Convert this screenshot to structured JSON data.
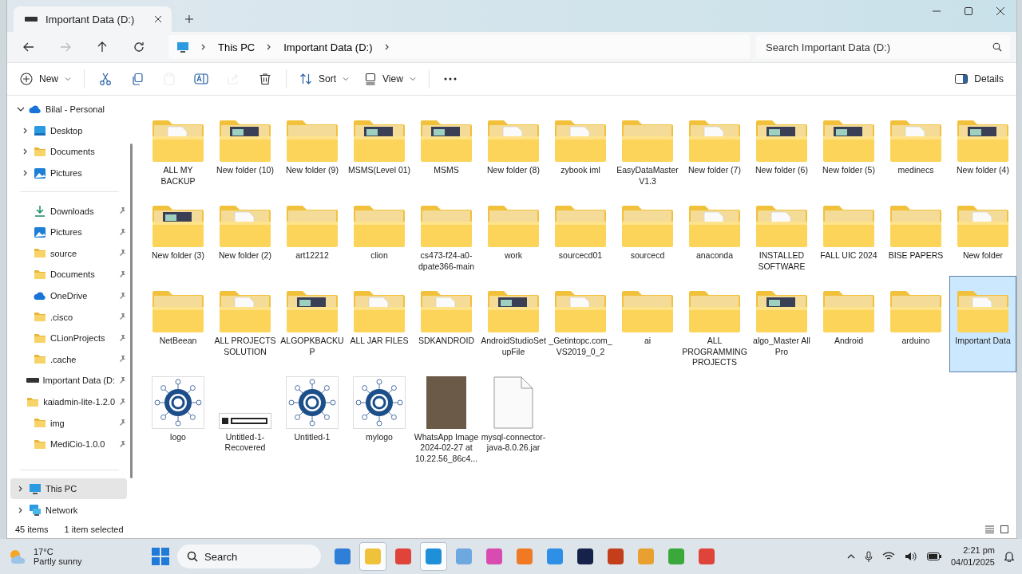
{
  "tab": {
    "title": "Important Data (D:)",
    "selected": true
  },
  "nav": [
    {
      "kind": "back",
      "disabled": false
    },
    {
      "kind": "forward",
      "disabled": true
    },
    {
      "kind": "up",
      "disabled": false
    },
    {
      "kind": "refresh",
      "disabled": false
    }
  ],
  "breadcrumb": [
    "This PC",
    "Important Data (D:)"
  ],
  "search": {
    "placeholder": "Search Important Data (D:)"
  },
  "toolbar": [
    {
      "kind": "new",
      "label": "New",
      "disabled": false
    },
    {
      "kind": "cut",
      "disabled": false
    },
    {
      "kind": "copy",
      "disabled": false
    },
    {
      "kind": "paste",
      "disabled": true
    },
    {
      "kind": "rename",
      "disabled": false
    },
    {
      "kind": "share",
      "disabled": true
    },
    {
      "kind": "delete",
      "disabled": false
    },
    {
      "kind": "sort",
      "label": "Sort",
      "disabled": false
    },
    {
      "kind": "view",
      "label": "View",
      "disabled": false
    },
    {
      "kind": "more",
      "disabled": false
    }
  ],
  "details_button": "Details",
  "sidebar": {
    "sections": [
      [
        {
          "label": "Bilal - Personal",
          "kind": "cloud",
          "expanded": true,
          "children": [
            {
              "label": "Desktop",
              "kind": "desktop",
              "expanded": false
            },
            {
              "label": "Documents",
              "kind": "folder",
              "expanded": false
            },
            {
              "label": "Pictures",
              "kind": "pictures",
              "expanded": false
            }
          ]
        }
      ],
      [
        {
          "label": "Downloads",
          "kind": "download",
          "pinned": true
        },
        {
          "label": "Pictures",
          "kind": "pictures",
          "pinned": true
        },
        {
          "label": "source",
          "kind": "folder",
          "pinned": true
        },
        {
          "label": "Documents",
          "kind": "folder",
          "pinned": true
        },
        {
          "label": "OneDrive",
          "kind": "cloud",
          "pinned": true
        },
        {
          "label": ".cisco",
          "kind": "folder",
          "pinned": true
        },
        {
          "label": "CLionProjects",
          "kind": "folder",
          "pinned": true
        },
        {
          "label": ".cache",
          "kind": "folder",
          "pinned": true
        },
        {
          "label": "Important Data (D:",
          "kind": "drive",
          "pinned": true
        },
        {
          "label": "kaiadmin-lite-1.2.0",
          "kind": "folder",
          "pinned": true
        },
        {
          "label": "img",
          "kind": "folder",
          "pinned": true
        },
        {
          "label": "MediCio-1.0.0",
          "kind": "folder",
          "pinned": true
        }
      ],
      [
        {
          "label": "This PC",
          "kind": "pc",
          "expanded": false,
          "selected": true
        },
        {
          "label": "Network",
          "kind": "network",
          "expanded": false,
          "selected": false
        }
      ]
    ]
  },
  "items": [
    {
      "name": "ALL MY BACKUP",
      "kind": "docfolder",
      "selected": false
    },
    {
      "name": "New folder (10)",
      "kind": "picfolder",
      "selected": false
    },
    {
      "name": "New folder (9)",
      "kind": "folder",
      "selected": false
    },
    {
      "name": "MSMS(Level 01)",
      "kind": "picfolder",
      "selected": false
    },
    {
      "name": "MSMS",
      "kind": "picfolder",
      "selected": false
    },
    {
      "name": "New folder (8)",
      "kind": "docfolder",
      "selected": false
    },
    {
      "name": "zybook iml",
      "kind": "docfolder",
      "selected": false
    },
    {
      "name": "EasyDataMaster V1.3",
      "kind": "folder",
      "selected": false
    },
    {
      "name": "New folder (7)",
      "kind": "docfolder",
      "selected": false
    },
    {
      "name": "New folder (6)",
      "kind": "picfolder",
      "selected": false
    },
    {
      "name": "New folder (5)",
      "kind": "picfolder",
      "selected": false
    },
    {
      "name": "medinecs",
      "kind": "docfolder",
      "selected": false
    },
    {
      "name": "New folder (4)",
      "kind": "picfolder",
      "selected": false
    },
    {
      "name": "New folder (3)",
      "kind": "picfolder",
      "selected": false
    },
    {
      "name": "New folder (2)",
      "kind": "docfolder",
      "selected": false
    },
    {
      "name": "art12212",
      "kind": "folder",
      "selected": false
    },
    {
      "name": "clion",
      "kind": "folder",
      "selected": false
    },
    {
      "name": "cs473-f24-a0-dpate366-main",
      "kind": "folder",
      "selected": false
    },
    {
      "name": "work",
      "kind": "folder",
      "selected": false
    },
    {
      "name": "sourcecd01",
      "kind": "folder",
      "selected": false
    },
    {
      "name": "sourcecd",
      "kind": "folder",
      "selected": false
    },
    {
      "name": "anaconda",
      "kind": "docfolder",
      "selected": false
    },
    {
      "name": "INSTALLED SOFTWARE",
      "kind": "docfolder",
      "selected": false
    },
    {
      "name": "FALL UIC 2024",
      "kind": "folder",
      "selected": false
    },
    {
      "name": "BISE PAPERS",
      "kind": "folder",
      "selected": false
    },
    {
      "name": "New folder",
      "kind": "docfolder",
      "selected": false
    },
    {
      "name": "NetBeean",
      "kind": "folder",
      "selected": false
    },
    {
      "name": "ALL PROJECTS SOLUTION",
      "kind": "docfolder",
      "selected": false
    },
    {
      "name": "ALGOPKBACKUP",
      "kind": "picfolder",
      "selected": false
    },
    {
      "name": "ALL JAR FILES",
      "kind": "docfolder",
      "selected": false
    },
    {
      "name": "SDKANDROID",
      "kind": "docfolder",
      "selected": false
    },
    {
      "name": "AndroidStudioSetupFile",
      "kind": "picfolder",
      "selected": false
    },
    {
      "name": "_Getintopc.com_VS2019_0_2",
      "kind": "docfolder",
      "selected": false
    },
    {
      "name": "ai",
      "kind": "folder",
      "selected": false
    },
    {
      "name": "ALL PROGRAMMING PROJECTS",
      "kind": "folder",
      "selected": false
    },
    {
      "name": "algo_Master All Pro",
      "kind": "picfolder",
      "selected": false
    },
    {
      "name": "Android",
      "kind": "folder",
      "selected": false
    },
    {
      "name": "arduino",
      "kind": "folder",
      "selected": false
    },
    {
      "name": "Important Data",
      "kind": "docfolder",
      "selected": true
    },
    {
      "name": "logo",
      "kind": "logo",
      "selected": false
    },
    {
      "name": "Untitled-1-Recovered",
      "kind": "banner",
      "selected": false
    },
    {
      "name": "Untitled-1",
      "kind": "logo",
      "selected": false
    },
    {
      "name": "mylogo",
      "kind": "logo",
      "selected": false
    },
    {
      "name": "WhatsApp Image 2024-02-27 at 10.22.56_86c4...",
      "kind": "photo",
      "selected": false
    },
    {
      "name": "mysql-connector-java-8.0.26.jar",
      "kind": "file",
      "selected": false
    }
  ],
  "status_bar": {
    "count": "45 items",
    "selection": "1 item selected"
  },
  "taskbar": {
    "temperature": "17°C",
    "weather": "Partly sunny",
    "search": "Search",
    "apps": [
      {
        "color": "#2f7fd8",
        "selected": false
      },
      {
        "color": "#f0c23b",
        "selected": true
      },
      {
        "color": "#e0433a",
        "selected": false
      },
      {
        "color": "#1f8fd8",
        "selected": true
      },
      {
        "color": "#6ea8e0",
        "selected": false
      },
      {
        "color": "#d84bb0",
        "selected": false
      },
      {
        "color": "#f07a24",
        "selected": false
      },
      {
        "color": "#2d8fe6",
        "selected": false
      },
      {
        "color": "#16224a",
        "selected": false
      },
      {
        "color": "#c43e1c",
        "selected": false
      },
      {
        "color": "#e8a030",
        "selected": false
      },
      {
        "color": "#3aa83a",
        "selected": false
      },
      {
        "color": "#e0433a",
        "selected": false
      }
    ],
    "time": "2:21 pm",
    "date": "04/01/2025"
  }
}
